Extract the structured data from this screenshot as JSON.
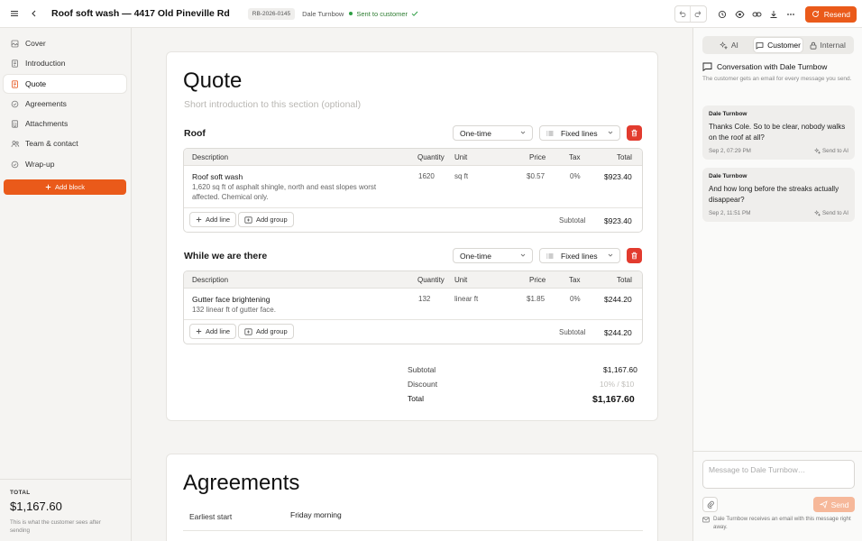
{
  "topbar": {
    "title": "Roof soft wash — 4417 Old Pineville Rd",
    "reference": "RB-2026-0145",
    "customer_name": "Dale Turnbow",
    "status": "Sent to customer",
    "resend_label": "Resend",
    "status_color": "#2e9e44",
    "accent_color": "#ea5a1a"
  },
  "sidebar": {
    "items": [
      {
        "label": "Cover",
        "icon": "cover-icon"
      },
      {
        "label": "Introduction",
        "icon": "document-icon"
      },
      {
        "label": "Quote",
        "icon": "quote-icon",
        "active": true
      },
      {
        "label": "Agreements",
        "icon": "agreements-icon"
      },
      {
        "label": "Attachments",
        "icon": "paperclip-icon"
      },
      {
        "label": "Team & contact",
        "icon": "team-icon"
      },
      {
        "label": "Wrap-up",
        "icon": "check-circle-icon"
      }
    ],
    "add_block_label": "Add block",
    "total_label": "TOTAL",
    "total_value": "$1,167.60",
    "total_note": "This is what the customer sees after sending"
  },
  "quote": {
    "heading": "Quote",
    "intro_placeholder": "Short introduction to this section (optional)",
    "columns": [
      "Description",
      "Quantity",
      "Unit",
      "Price",
      "Tax",
      "Total"
    ],
    "add_line_label": "Add line",
    "add_group_label": "Add group",
    "subtotal_label": "Subtotal",
    "sections": [
      {
        "title": "Roof",
        "frequency": "One-time",
        "line_mode": "Fixed lines",
        "items": [
          {
            "name": "Roof soft wash",
            "description": "1,620 sq ft of asphalt shingle, north and east slopes worst affected. Chemical only.",
            "quantity": "1620",
            "unit": "sq ft",
            "price": "$0.57",
            "tax": "0%",
            "total": "$923.40"
          }
        ],
        "subtotal": "$923.40"
      },
      {
        "title": "While we are there",
        "frequency": "One-time",
        "line_mode": "Fixed lines",
        "items": [
          {
            "name": "Gutter face brightening",
            "description": "132 linear ft of gutter face.",
            "quantity": "132",
            "unit": "linear ft",
            "price": "$1.85",
            "tax": "0%",
            "total": "$244.20"
          }
        ],
        "subtotal": "$244.20"
      }
    ],
    "summary": {
      "subtotal_label": "Subtotal",
      "subtotal_value": "$1,167.60",
      "discount_label": "Discount",
      "discount_placeholder": "10% / $10",
      "total_label": "Total",
      "total_value": "$1,167.60"
    }
  },
  "agreements": {
    "heading": "Agreements",
    "rows": [
      {
        "label": "Earliest start",
        "value": "Friday morning"
      }
    ]
  },
  "panel": {
    "tabs": [
      {
        "label": "AI",
        "icon": "sparkle-icon"
      },
      {
        "label": "Customer",
        "icon": "chat-icon",
        "active": true
      },
      {
        "label": "Internal",
        "icon": "lock-icon"
      }
    ],
    "conversation_title": "Conversation with Dale Turnbow",
    "conversation_subtitle": "The customer gets an email for every message you send.",
    "messages": [
      {
        "author": "Dale Turnbow",
        "text": "Thanks Cole. So to be clear, nobody walks on the roof at all?",
        "time": "Sep 2, 07:29 PM",
        "action": "Send to AI"
      },
      {
        "author": "Dale Turnbow",
        "text": "And how long before the streaks actually disappear?",
        "time": "Sep 2, 11:51 PM",
        "action": "Send to AI"
      }
    ],
    "compose_placeholder": "Message to Dale Turnbow…",
    "send_label": "Send",
    "send_note": "Dale Turnbow receives an email with this message right away."
  }
}
